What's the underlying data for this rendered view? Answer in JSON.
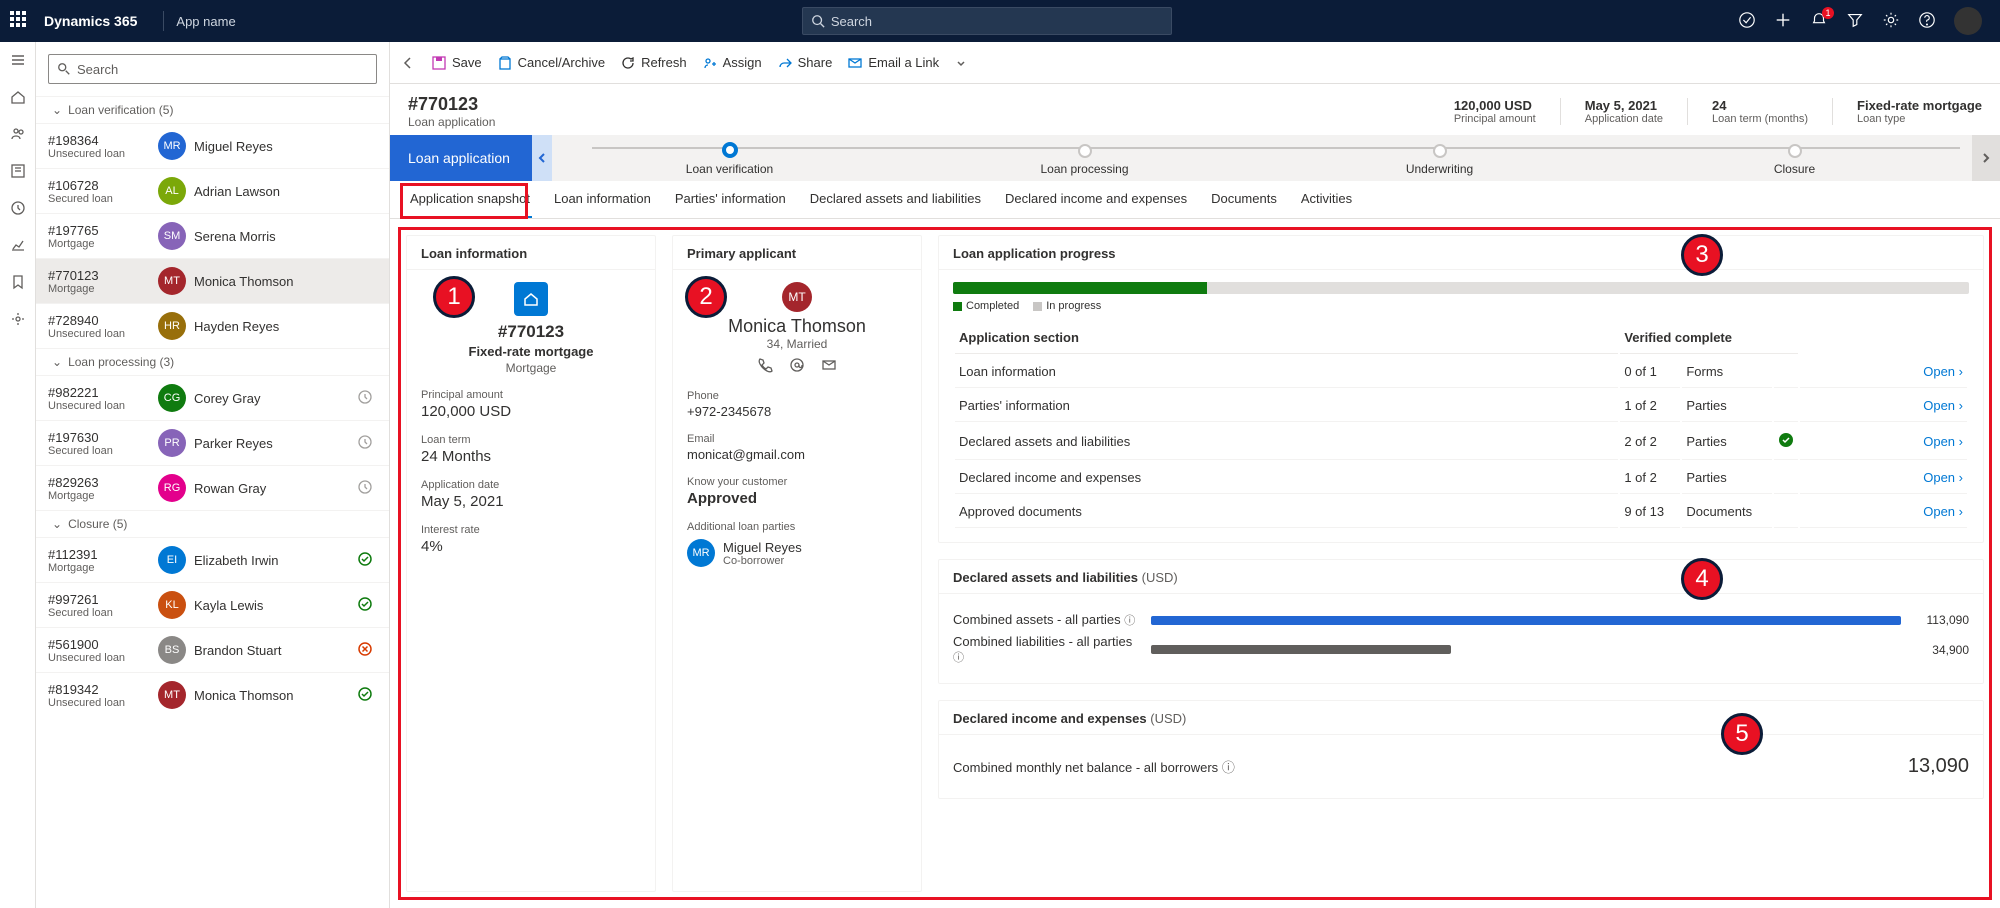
{
  "topbar": {
    "brand": "Dynamics 365",
    "appname": "App name",
    "search_placeholder": "Search"
  },
  "sidebar": {
    "search_placeholder": "Search",
    "groups": [
      {
        "label": "Loan verification (5)",
        "items": [
          {
            "id": "#198364",
            "type": "Unsecured loan",
            "initials": "MR",
            "name": "Miguel Reyes",
            "color": "#2266d3"
          },
          {
            "id": "#106728",
            "type": "Secured loan",
            "initials": "AL",
            "name": "Adrian Lawson",
            "color": "#7ba809"
          },
          {
            "id": "#197765",
            "type": "Mortgage",
            "initials": "SM",
            "name": "Serena Morris",
            "color": "#8764b8"
          },
          {
            "id": "#770123",
            "type": "Mortgage",
            "initials": "MT",
            "name": "Monica Thomson",
            "color": "#a4262c",
            "selected": true
          },
          {
            "id": "#728940",
            "type": "Unsecured loan",
            "initials": "HR",
            "name": "Hayden Reyes",
            "color": "#986f0b"
          }
        ]
      },
      {
        "label": "Loan processing (3)",
        "items": [
          {
            "id": "#982221",
            "type": "Unsecured loan",
            "initials": "CG",
            "name": "Corey Gray",
            "color": "#0f7b0f",
            "status": "clock"
          },
          {
            "id": "#197630",
            "type": "Secured loan",
            "initials": "PR",
            "name": "Parker Reyes",
            "color": "#8764b8",
            "status": "clock"
          },
          {
            "id": "#829263",
            "type": "Mortgage",
            "initials": "RG",
            "name": "Rowan Gray",
            "color": "#e3008c",
            "status": "clock"
          }
        ]
      },
      {
        "label": "Closure (5)",
        "items": [
          {
            "id": "#112391",
            "type": "Mortgage",
            "initials": "EI",
            "name": "Elizabeth Irwin",
            "color": "#0078d4",
            "status": "check"
          },
          {
            "id": "#997261",
            "type": "Secured loan",
            "initials": "KL",
            "name": "Kayla Lewis",
            "color": "#ca5010",
            "status": "check"
          },
          {
            "id": "#561900",
            "type": "Unsecured loan",
            "initials": "BS",
            "name": "Brandon Stuart",
            "color": "#8a8886",
            "status": "error"
          },
          {
            "id": "#819342",
            "type": "Unsecured loan",
            "initials": "MT",
            "name": "Monica Thomson",
            "color": "#a4262c",
            "status": "check"
          }
        ]
      }
    ]
  },
  "commands": {
    "save": "Save",
    "cancel": "Cancel/Archive",
    "refresh": "Refresh",
    "assign": "Assign",
    "share": "Share",
    "email": "Email a Link"
  },
  "header": {
    "id": "#770123",
    "subtitle": "Loan application",
    "stats": [
      {
        "v": "120,000 USD",
        "l": "Principal amount"
      },
      {
        "v": "May 5, 2021",
        "l": "Application date"
      },
      {
        "v": "24",
        "l": "Loan term (months)"
      },
      {
        "v": "Fixed-rate mortgage",
        "l": "Loan type"
      }
    ]
  },
  "process": {
    "stage": "Loan application",
    "steps": [
      "Loan verification",
      "Loan processing",
      "Underwriting",
      "Closure"
    ],
    "active": 0
  },
  "tabs": [
    "Application snapshot",
    "Loan information",
    "Parties' information",
    "Declared assets and liabilities",
    "Declared income and expenses",
    "Documents",
    "Activities"
  ],
  "loaninfo": {
    "title": "Loan information",
    "id": "#770123",
    "type": "Fixed-rate mortgage",
    "cat": "Mortgage",
    "fields": [
      {
        "l": "Principal amount",
        "v": "120,000 USD"
      },
      {
        "l": "Loan term",
        "v": "24 Months"
      },
      {
        "l": "Application date",
        "v": "May 5, 2021"
      },
      {
        "l": "Interest rate",
        "v": "4%"
      }
    ]
  },
  "applicant": {
    "title": "Primary applicant",
    "initials": "MT",
    "name": "Monica Thomson",
    "meta": "34, Married",
    "phone_l": "Phone",
    "phone": "+972-2345678",
    "email_l": "Email",
    "email": "monicat@gmail.com",
    "kyc_l": "Know your customer",
    "kyc": "Approved",
    "parties_l": "Additional loan parties",
    "party": {
      "initials": "MR",
      "name": "Miguel Reyes",
      "role": "Co-borrower"
    }
  },
  "progress": {
    "title": "Loan application progress",
    "percent": 25,
    "legend": {
      "completed": "Completed",
      "inprogress": "In progress"
    },
    "cols": {
      "a": "Application section",
      "b": "Verified complete"
    },
    "rows": [
      {
        "s": "Loan information",
        "c": "0 of 1",
        "t": "Forms",
        "ok": false
      },
      {
        "s": "Parties' information",
        "c": "1 of 2",
        "t": "Parties",
        "ok": false
      },
      {
        "s": "Declared assets and liabilities",
        "c": "2 of 2",
        "t": "Parties",
        "ok": true
      },
      {
        "s": "Declared income and expenses",
        "c": "1 of 2",
        "t": "Parties",
        "ok": false
      },
      {
        "s": "Approved documents",
        "c": "9 of 13",
        "t": "Documents",
        "ok": false
      }
    ],
    "open": "Open"
  },
  "assets": {
    "title": "Declared assets and liabilities",
    "unit": "(USD)",
    "a_label": "Combined assets - all parties",
    "a_val": "113,090",
    "a_pct": 100,
    "l_label": "Combined liabilities - all parties",
    "l_val": "34,900",
    "l_pct": 40
  },
  "income": {
    "title": "Declared income and expenses",
    "unit": "(USD)",
    "label": "Combined monthly net balance - all borrowers",
    "value": "13,090"
  },
  "chart_data": {
    "type": "bar",
    "title": "Declared assets and liabilities (USD)",
    "categories": [
      "Combined assets - all parties",
      "Combined liabilities - all parties"
    ],
    "values": [
      113090,
      34900
    ],
    "xlabel": "",
    "ylabel": "USD"
  }
}
